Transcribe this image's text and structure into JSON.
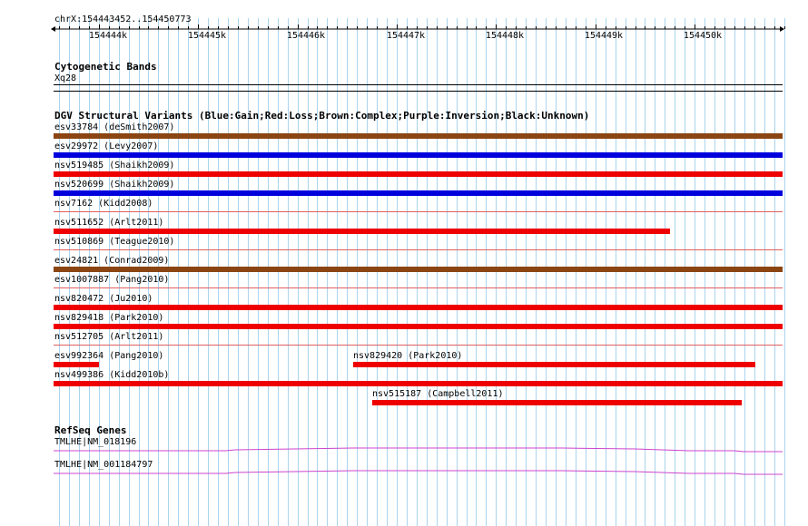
{
  "ruler": {
    "coordinates": "chrX:154443452..154450773",
    "ticks": [
      "154444k",
      "154445k",
      "154446k",
      "154447k",
      "154448k",
      "154449k",
      "154450k"
    ]
  },
  "cytoband": {
    "title": "Cytogenetic Bands",
    "band": "Xq28"
  },
  "dgv": {
    "title": "DGV Structural Variants (Blue:Gain;Red:Loss;Brown:Complex;Purple:Inversion;Black:Unknown)",
    "colors": {
      "gain": "#0000dd",
      "loss": "#ee0000",
      "complex": "#8b4513"
    },
    "variants": [
      {
        "label": "esv33784 (deSmith2007)",
        "type": "complex"
      },
      {
        "label": "esv29972 (Levy2007)",
        "type": "gain"
      },
      {
        "label": "nsv519485 (Shaikh2009)",
        "type": "loss"
      },
      {
        "label": "nsv520699 (Shaikh2009)",
        "type": "gain"
      },
      {
        "label": "nsv7162 (Kidd2008)",
        "type": "loss"
      },
      {
        "label": "nsv511652 (Arlt2011)",
        "type": "loss"
      },
      {
        "label": "nsv510869 (Teague2010)",
        "type": "loss"
      },
      {
        "label": "esv24821 (Conrad2009)",
        "type": "complex"
      },
      {
        "label": "esv1007887 (Pang2010)",
        "type": "loss"
      },
      {
        "label": "nsv820472 (Ju2010)",
        "type": "loss"
      },
      {
        "label": "nsv829418 (Park2010)",
        "type": "loss"
      },
      {
        "label": "nsv512705 (Arlt2011)",
        "type": "loss"
      },
      {
        "label": "esv992364 (Pang2010)",
        "type": "loss"
      },
      {
        "label": "nsv829420 (Park2010)",
        "type": "loss"
      },
      {
        "label": "nsv499386 (Kidd2010b)",
        "type": "loss"
      },
      {
        "label": "nsv515187 (Campbell2011)",
        "type": "loss"
      }
    ]
  },
  "refseq": {
    "title": "RefSeq Genes",
    "color": "#cc44cc",
    "genes": [
      {
        "label": "TMLHE|NM_018196"
      },
      {
        "label": "TMLHE|NM_001184797"
      }
    ]
  }
}
